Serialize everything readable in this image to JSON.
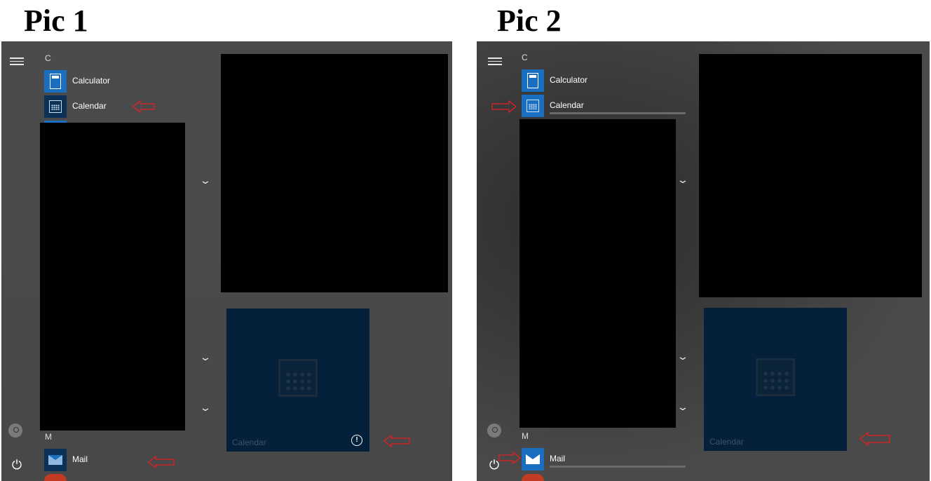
{
  "pic1": {
    "title": "Pic 1",
    "section_c": "C",
    "section_m": "M",
    "apps": {
      "calculator": "Calculator",
      "calendar": "Calendar",
      "mail": "Mail"
    },
    "calendar_tile_label": "Calendar",
    "info_badge": "!"
  },
  "pic2": {
    "title": "Pic 2",
    "section_c": "C",
    "section_m": "M",
    "apps": {
      "calculator": "Calculator",
      "calendar": "Calendar",
      "mail": "Mail"
    },
    "calendar_tile_label": "Calendar"
  },
  "colors": {
    "annotation_arrow": "#e02020",
    "app_tile_blue": "#1a6fc0",
    "live_tile_bg": "#05203a"
  },
  "icons": {
    "menu": "hamburger-icon",
    "user": "user-icon",
    "power": "power-icon",
    "expand": "chevron-down-icon"
  }
}
